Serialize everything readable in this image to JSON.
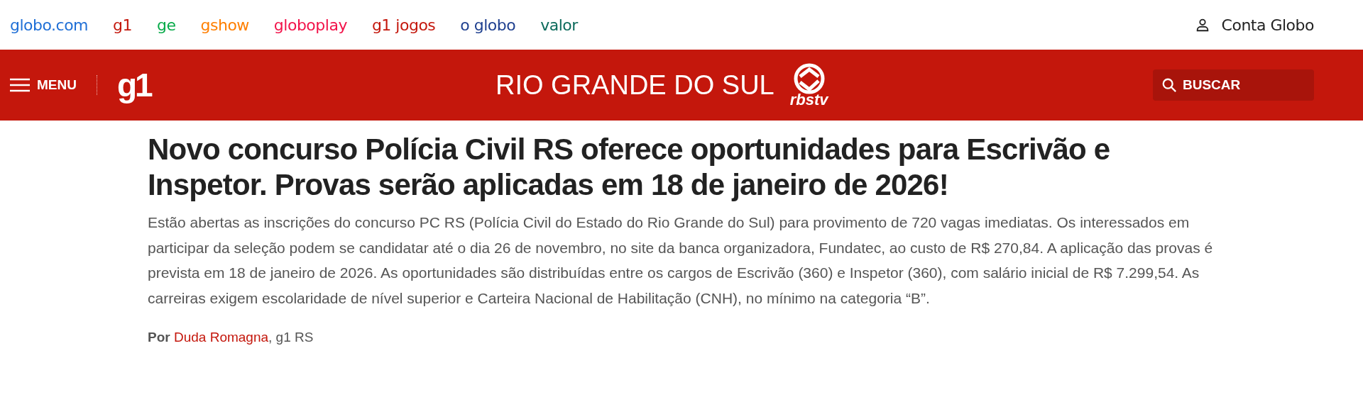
{
  "top_nav": {
    "links": [
      {
        "label": "globo.com",
        "color": "#1f6fd6"
      },
      {
        "label": "g1",
        "color": "#c4170c"
      },
      {
        "label": "ge",
        "color": "#06aa48"
      },
      {
        "label": "gshow",
        "color": "#ff7f00"
      },
      {
        "label": "globoplay",
        "color": "#f2134a"
      },
      {
        "label": "g1 jogos",
        "color": "#c4170c"
      },
      {
        "label": "o globo",
        "color": "#1e3f8f"
      },
      {
        "label": "valor",
        "color": "#0d6b5c"
      }
    ],
    "account": "Conta Globo"
  },
  "header": {
    "menu": "MENU",
    "logo": "g1",
    "region": "RIO GRANDE DO SUL",
    "affiliate": "rbstv",
    "search": "BUSCAR"
  },
  "article": {
    "title": "Novo concurso Polícia Civil RS oferece oportunidades para Escrivão e Inspetor. Provas serão aplicadas em 18 de janeiro de 2026!",
    "subtitle": "Estão abertas as inscrições do concurso PC RS (Polícia Civil do Estado do Rio Grande do Sul) para provimento de 720 vagas imediatas. Os interessados em participar da seleção podem se candidatar até o dia 26 de novembro, no site da banca organizadora, Fundatec, ao custo de R$ 270,84. A aplicação das provas é prevista em 18 de janeiro de 2026. As oportunidades são distribuídas entre os cargos de Escrivão (360) e Inspetor (360), com salário inicial de R$ 7.299,54. As carreiras exigem escolaridade de nível superior e Carteira Nacional de Habilitação (CNH), no mínimo na categoria “B”.",
    "byline": {
      "prefix": "Por",
      "author": "Duda Romagna",
      "suffix": ", g1 RS"
    }
  }
}
